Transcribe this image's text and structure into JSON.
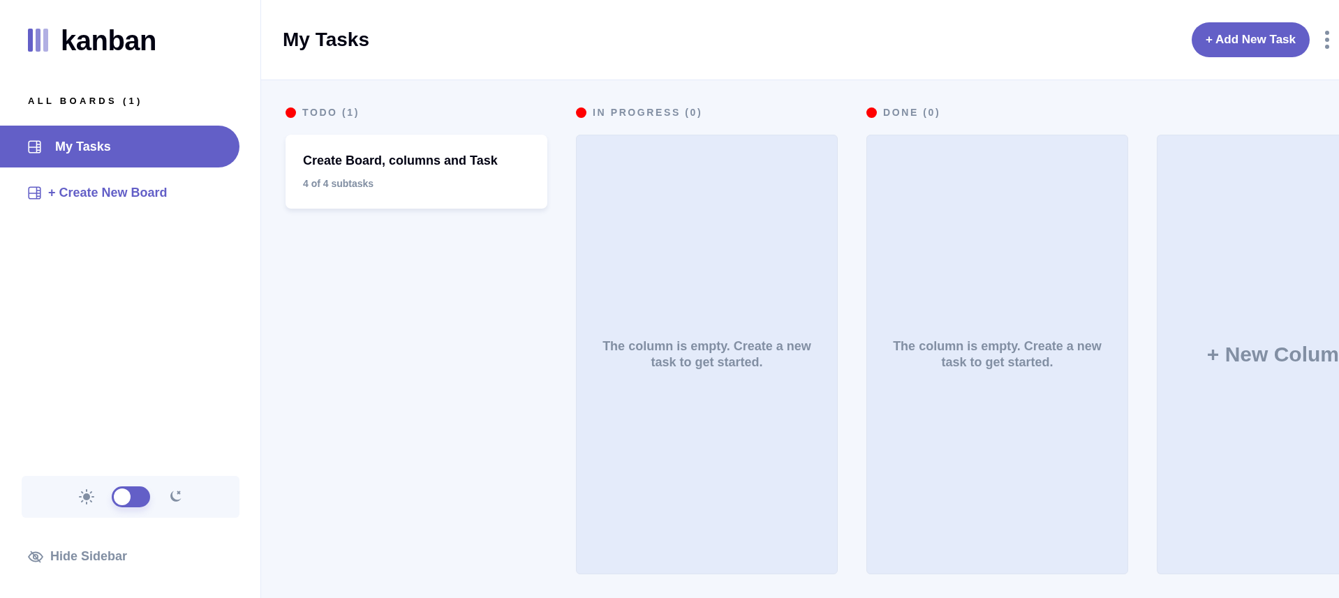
{
  "logo": {
    "text": "kanban"
  },
  "sidebar": {
    "heading": "ALL BOARDS (1)",
    "boards": [
      {
        "label": "My Tasks",
        "selected": true
      }
    ],
    "create_board": "+ Create New Board",
    "theme": {
      "dark_mode": false
    },
    "hide_sidebar": "Hide Sidebar"
  },
  "header": {
    "title": "My Tasks",
    "add_task": "+ Add New Task"
  },
  "columns": [
    {
      "title": "TODO (1)",
      "color": "#ff0000",
      "tasks": [
        {
          "title": "Create Board, columns and Task",
          "subtasks": "4 of 4 subtasks"
        }
      ]
    },
    {
      "title": "IN PROGRESS (0)",
      "color": "#ff0000",
      "empty_text": "The column is empty. Create a new task to get started."
    },
    {
      "title": "DONE (0)",
      "color": "#ff0000",
      "empty_text": "The column is empty. Create a new task to get started."
    }
  ],
  "new_column": "+ New Colum"
}
